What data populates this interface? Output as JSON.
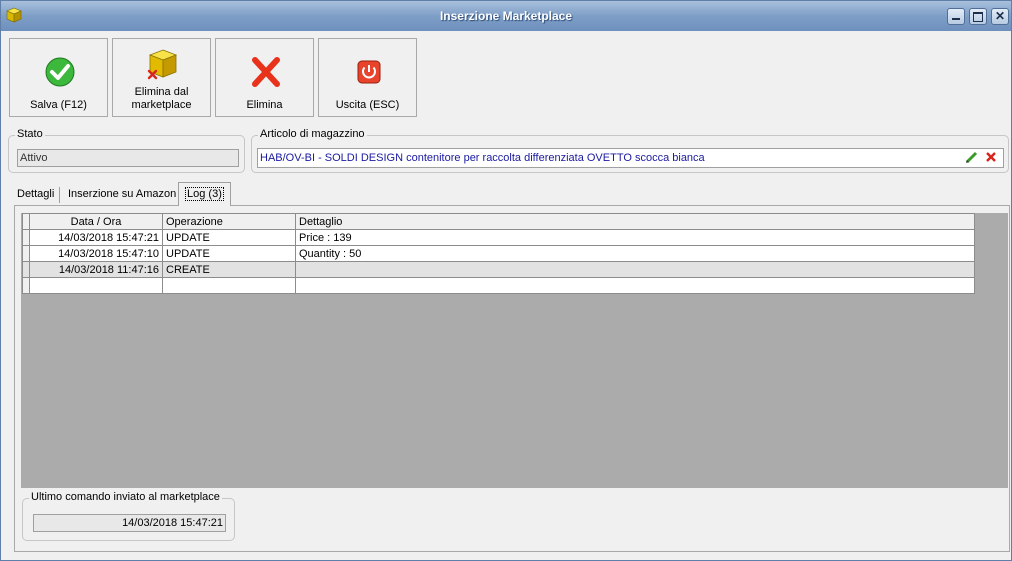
{
  "window": {
    "title": "Inserzione Marketplace",
    "icon": "cube-icon"
  },
  "toolbar": {
    "save_label": "Salva (F12)",
    "remove_label_line1": "Elimina dal",
    "remove_label_line2": "marketplace",
    "delete_label": "Elimina",
    "exit_label": "Uscita (ESC)"
  },
  "stato": {
    "label": "Stato",
    "value": "Attivo"
  },
  "articolo": {
    "label": "Articolo di magazzino",
    "value": "HAB/OV-BI - SOLDI DESIGN contenitore per raccolta differenziata OVETTO scocca bianca"
  },
  "tabs": [
    {
      "label": "Dettagli"
    },
    {
      "label": "Inserzione su Amazon"
    },
    {
      "label": "Log (3)"
    }
  ],
  "log": {
    "columns": [
      "Data / Ora",
      "Operazione",
      "Dettaglio"
    ],
    "rows": [
      {
        "date": "14/03/2018 15:47:21",
        "op": "UPDATE",
        "detail": "Price : 139"
      },
      {
        "date": "14/03/2018 15:47:10",
        "op": "UPDATE",
        "detail": "Quantity : 50"
      },
      {
        "date": "14/03/2018 11:47:16",
        "op": "CREATE",
        "detail": ""
      }
    ]
  },
  "last_command": {
    "label": "Ultimo comando inviato al marketplace",
    "value": "14/03/2018 15:47:21"
  },
  "colors": {
    "title_bar": "#7e9ec6",
    "article_text": "#1a1aa0",
    "grid_bg": "#ababab"
  }
}
